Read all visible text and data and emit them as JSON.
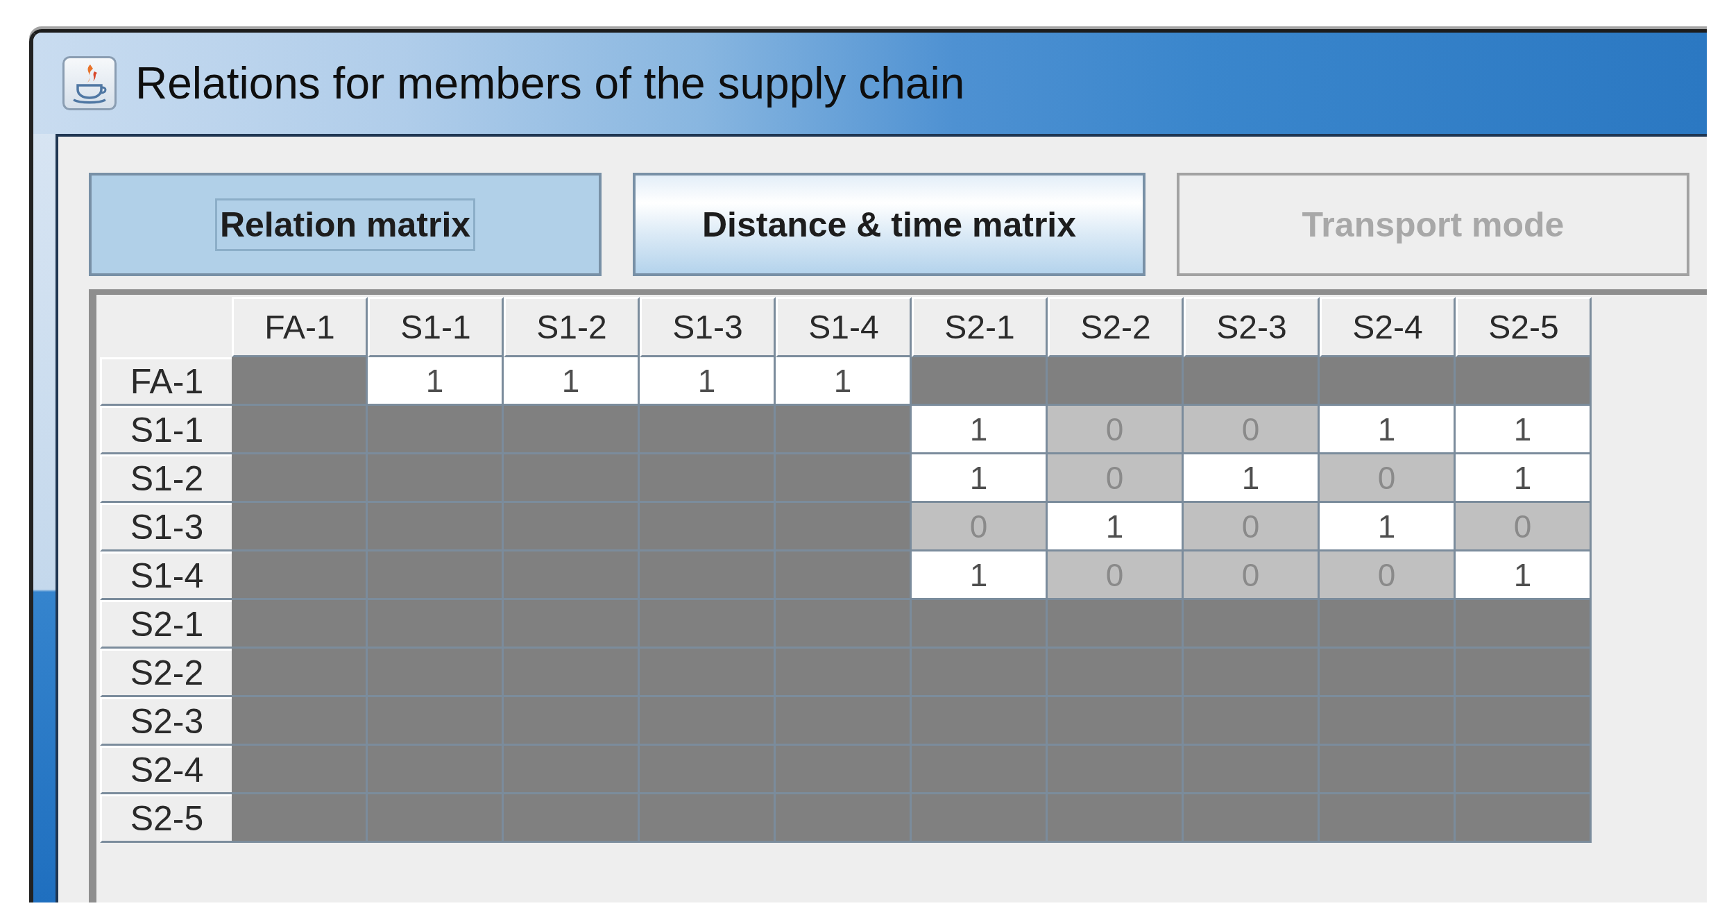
{
  "window": {
    "title": "Relations for members of the supply chain"
  },
  "tabs": [
    {
      "label": "Relation matrix",
      "selected": true,
      "focused": true,
      "disabled": false
    },
    {
      "label": "Distance & time matrix",
      "selected": false,
      "focused": false,
      "disabled": false
    },
    {
      "label": "Transport mode",
      "selected": false,
      "focused": false,
      "disabled": true
    }
  ],
  "table": {
    "columns": [
      "FA-1",
      "S1-1",
      "S1-2",
      "S1-3",
      "S1-4",
      "S2-1",
      "S2-2",
      "S2-3",
      "S2-4",
      "S2-5"
    ],
    "rows": [
      {
        "header": "FA-1",
        "cells": [
          {
            "kind": "blocked"
          },
          {
            "kind": "entry",
            "value": "1",
            "on": true
          },
          {
            "kind": "entry",
            "value": "1",
            "on": true
          },
          {
            "kind": "entry",
            "value": "1",
            "on": true
          },
          {
            "kind": "entry",
            "value": "1",
            "on": true
          },
          {
            "kind": "blocked"
          },
          {
            "kind": "blocked"
          },
          {
            "kind": "blocked"
          },
          {
            "kind": "blocked"
          },
          {
            "kind": "blocked"
          }
        ]
      },
      {
        "header": "S1-1",
        "cells": [
          {
            "kind": "blocked"
          },
          {
            "kind": "blocked"
          },
          {
            "kind": "blocked"
          },
          {
            "kind": "blocked"
          },
          {
            "kind": "blocked"
          },
          {
            "kind": "entry",
            "value": "1",
            "on": true
          },
          {
            "kind": "entry",
            "value": "0",
            "on": false
          },
          {
            "kind": "entry",
            "value": "0",
            "on": false
          },
          {
            "kind": "entry",
            "value": "1",
            "on": true
          },
          {
            "kind": "entry",
            "value": "1",
            "on": true
          }
        ]
      },
      {
        "header": "S1-2",
        "cells": [
          {
            "kind": "blocked"
          },
          {
            "kind": "blocked"
          },
          {
            "kind": "blocked"
          },
          {
            "kind": "blocked"
          },
          {
            "kind": "blocked"
          },
          {
            "kind": "entry",
            "value": "1",
            "on": true
          },
          {
            "kind": "entry",
            "value": "0",
            "on": false
          },
          {
            "kind": "entry",
            "value": "1",
            "on": true
          },
          {
            "kind": "entry",
            "value": "0",
            "on": false
          },
          {
            "kind": "entry",
            "value": "1",
            "on": true
          }
        ]
      },
      {
        "header": "S1-3",
        "cells": [
          {
            "kind": "blocked"
          },
          {
            "kind": "blocked"
          },
          {
            "kind": "blocked"
          },
          {
            "kind": "blocked"
          },
          {
            "kind": "blocked"
          },
          {
            "kind": "entry",
            "value": "0",
            "on": false
          },
          {
            "kind": "entry",
            "value": "1",
            "on": true
          },
          {
            "kind": "entry",
            "value": "0",
            "on": false
          },
          {
            "kind": "entry",
            "value": "1",
            "on": true
          },
          {
            "kind": "entry",
            "value": "0",
            "on": false
          }
        ]
      },
      {
        "header": "S1-4",
        "cells": [
          {
            "kind": "blocked"
          },
          {
            "kind": "blocked"
          },
          {
            "kind": "blocked"
          },
          {
            "kind": "blocked"
          },
          {
            "kind": "blocked"
          },
          {
            "kind": "entry",
            "value": "1",
            "on": true
          },
          {
            "kind": "entry",
            "value": "0",
            "on": false
          },
          {
            "kind": "entry",
            "value": "0",
            "on": false
          },
          {
            "kind": "entry",
            "value": "0",
            "on": false
          },
          {
            "kind": "entry",
            "value": "1",
            "on": true
          }
        ]
      },
      {
        "header": "S2-1",
        "cells": [
          {
            "kind": "blocked"
          },
          {
            "kind": "blocked"
          },
          {
            "kind": "blocked"
          },
          {
            "kind": "blocked"
          },
          {
            "kind": "blocked"
          },
          {
            "kind": "blocked"
          },
          {
            "kind": "blocked"
          },
          {
            "kind": "blocked"
          },
          {
            "kind": "blocked"
          },
          {
            "kind": "blocked"
          }
        ]
      },
      {
        "header": "S2-2",
        "cells": [
          {
            "kind": "blocked"
          },
          {
            "kind": "blocked"
          },
          {
            "kind": "blocked"
          },
          {
            "kind": "blocked"
          },
          {
            "kind": "blocked"
          },
          {
            "kind": "blocked"
          },
          {
            "kind": "blocked"
          },
          {
            "kind": "blocked"
          },
          {
            "kind": "blocked"
          },
          {
            "kind": "blocked"
          }
        ]
      },
      {
        "header": "S2-3",
        "cells": [
          {
            "kind": "blocked"
          },
          {
            "kind": "blocked"
          },
          {
            "kind": "blocked"
          },
          {
            "kind": "blocked"
          },
          {
            "kind": "blocked"
          },
          {
            "kind": "blocked"
          },
          {
            "kind": "blocked"
          },
          {
            "kind": "blocked"
          },
          {
            "kind": "blocked"
          },
          {
            "kind": "blocked"
          }
        ]
      },
      {
        "header": "S2-4",
        "cells": [
          {
            "kind": "blocked"
          },
          {
            "kind": "blocked"
          },
          {
            "kind": "blocked"
          },
          {
            "kind": "blocked"
          },
          {
            "kind": "blocked"
          },
          {
            "kind": "blocked"
          },
          {
            "kind": "blocked"
          },
          {
            "kind": "blocked"
          },
          {
            "kind": "blocked"
          },
          {
            "kind": "blocked"
          }
        ]
      },
      {
        "header": "S2-5",
        "cells": [
          {
            "kind": "blocked"
          },
          {
            "kind": "blocked"
          },
          {
            "kind": "blocked"
          },
          {
            "kind": "blocked"
          },
          {
            "kind": "blocked"
          },
          {
            "kind": "blocked"
          },
          {
            "kind": "blocked"
          },
          {
            "kind": "blocked"
          },
          {
            "kind": "blocked"
          },
          {
            "kind": "blocked"
          }
        ]
      }
    ]
  }
}
